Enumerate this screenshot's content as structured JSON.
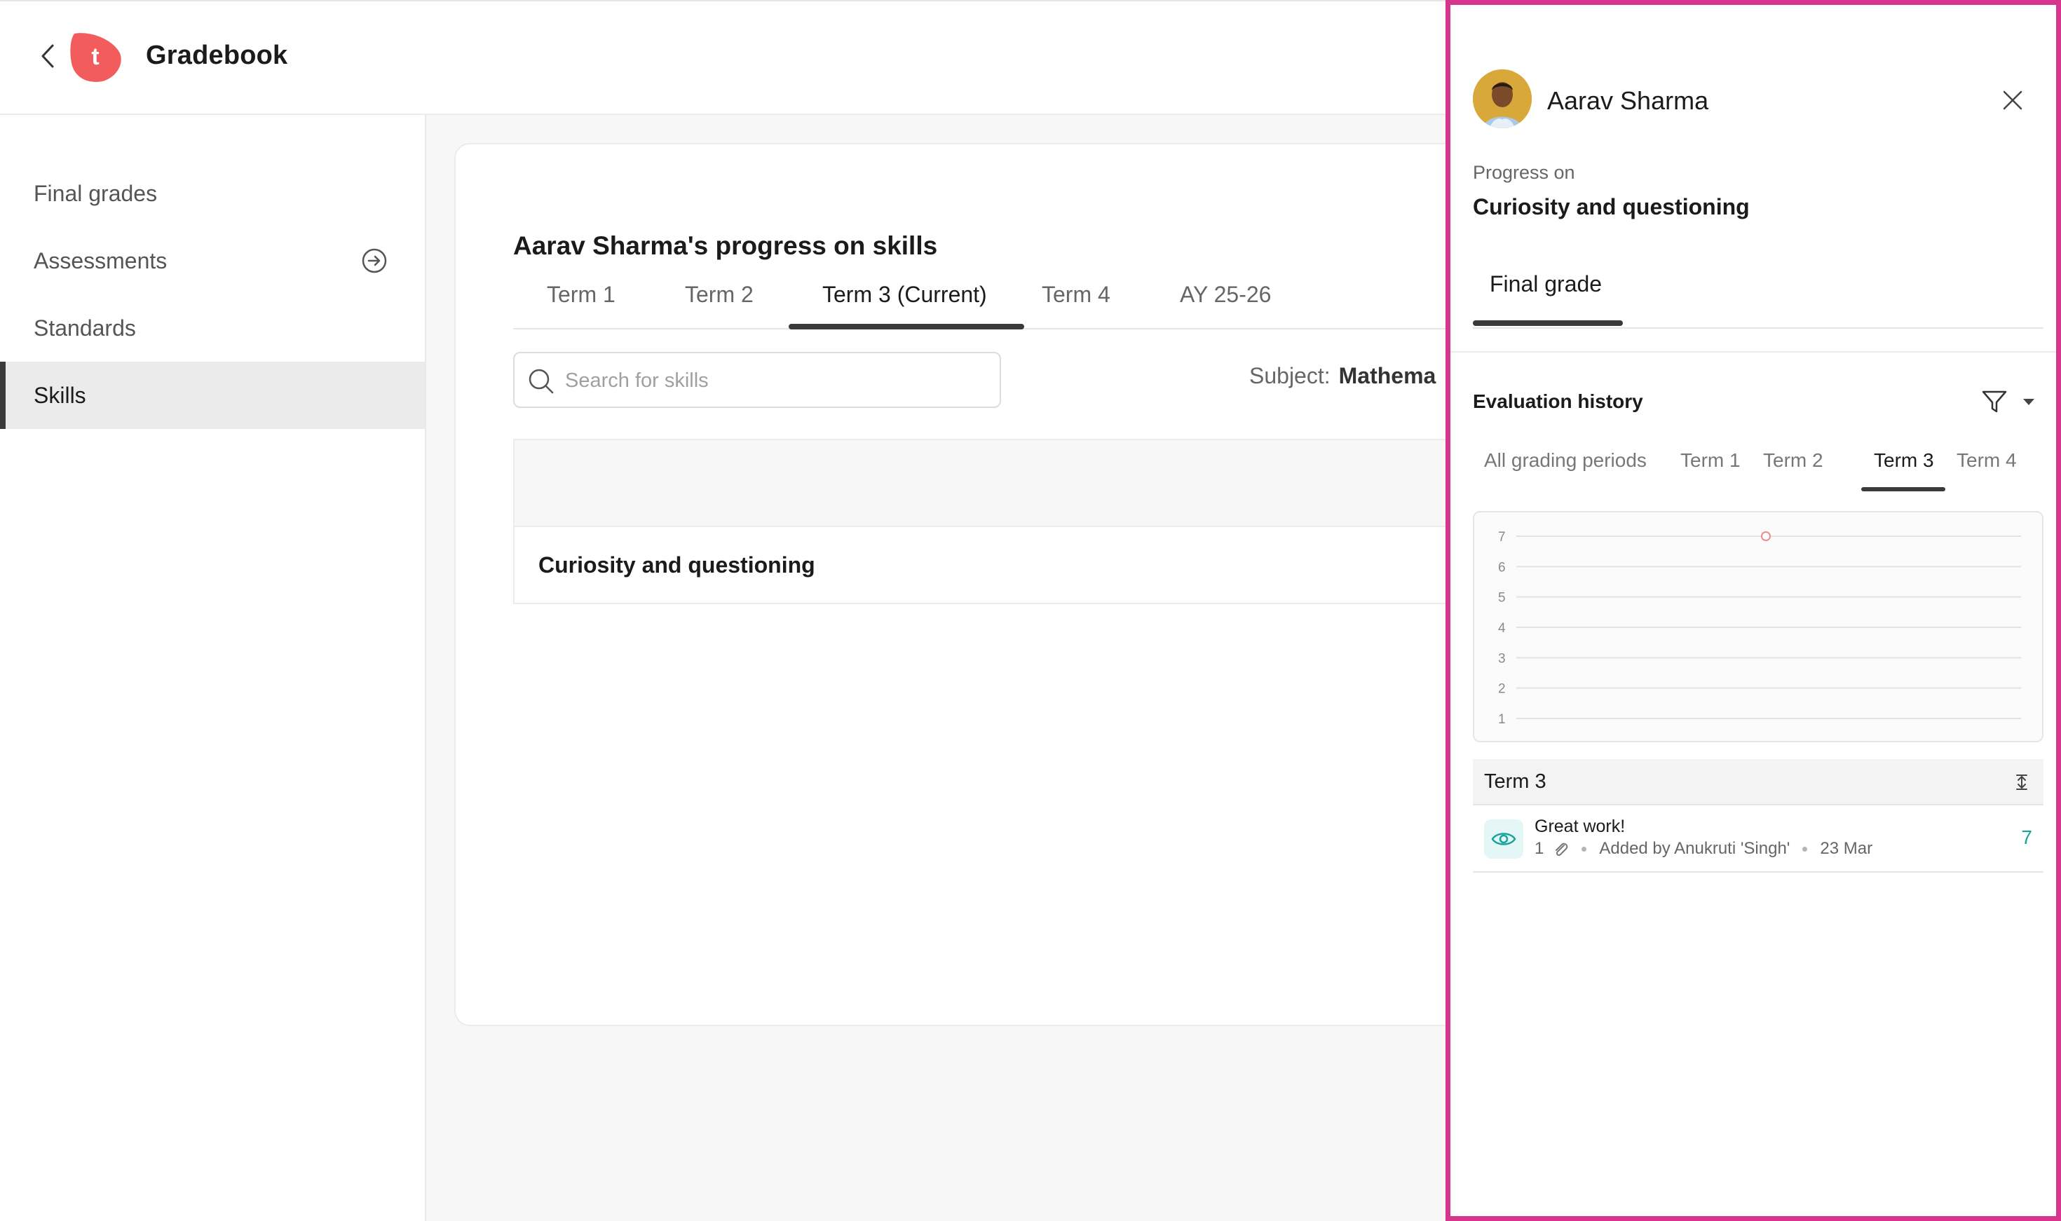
{
  "header": {
    "title": "Gradebook"
  },
  "sidebar": {
    "items": [
      {
        "label": "Final grades"
      },
      {
        "label": "Assessments"
      },
      {
        "label": "Standards"
      },
      {
        "label": "Skills"
      }
    ],
    "active": "Skills"
  },
  "main": {
    "title": "Aarav Sharma's progress on skills",
    "tabs": [
      {
        "label": "Term 1"
      },
      {
        "label": "Term 2"
      },
      {
        "label": "Term 3 (Current)"
      },
      {
        "label": "Term 4"
      },
      {
        "label": "AY 25-26"
      }
    ],
    "active_tab": "Term 3 (Current)",
    "search": {
      "placeholder": "Search for skills",
      "value": ""
    },
    "subject": {
      "label": "Subject:",
      "value": "Mathema"
    },
    "rows": [
      {
        "label": "Curiosity and questioning"
      }
    ]
  },
  "panel": {
    "student_name": "Aarav Sharma",
    "progress_label": "Progress on",
    "skill_name": "Curiosity and questioning",
    "final_grade_tab": "Final grade",
    "evaluation_title": "Evaluation history",
    "period_tabs": [
      {
        "label": "All grading periods"
      },
      {
        "label": "Term 1"
      },
      {
        "label": "Term 2"
      },
      {
        "label": "Term 3"
      },
      {
        "label": "Term 4"
      }
    ],
    "active_period": "Term 3",
    "group": {
      "label": "Term 3",
      "entries": [
        {
          "title": "Great work!",
          "attachments": "1",
          "added_by": "Added by Anukruti 'Singh'",
          "date": "23 Mar",
          "score": "7"
        }
      ]
    }
  },
  "chart_data": {
    "type": "scatter",
    "y_ticks": [
      "7",
      "6",
      "5",
      "4",
      "3",
      "2",
      "1"
    ],
    "ylim": [
      1,
      7
    ],
    "points": [
      {
        "y": 7
      }
    ],
    "grid": true
  },
  "colors": {
    "accent": "#d6358d",
    "brand": "#f25c5c",
    "score": "#1aa39a",
    "active_tab": "#3a3a3a"
  }
}
